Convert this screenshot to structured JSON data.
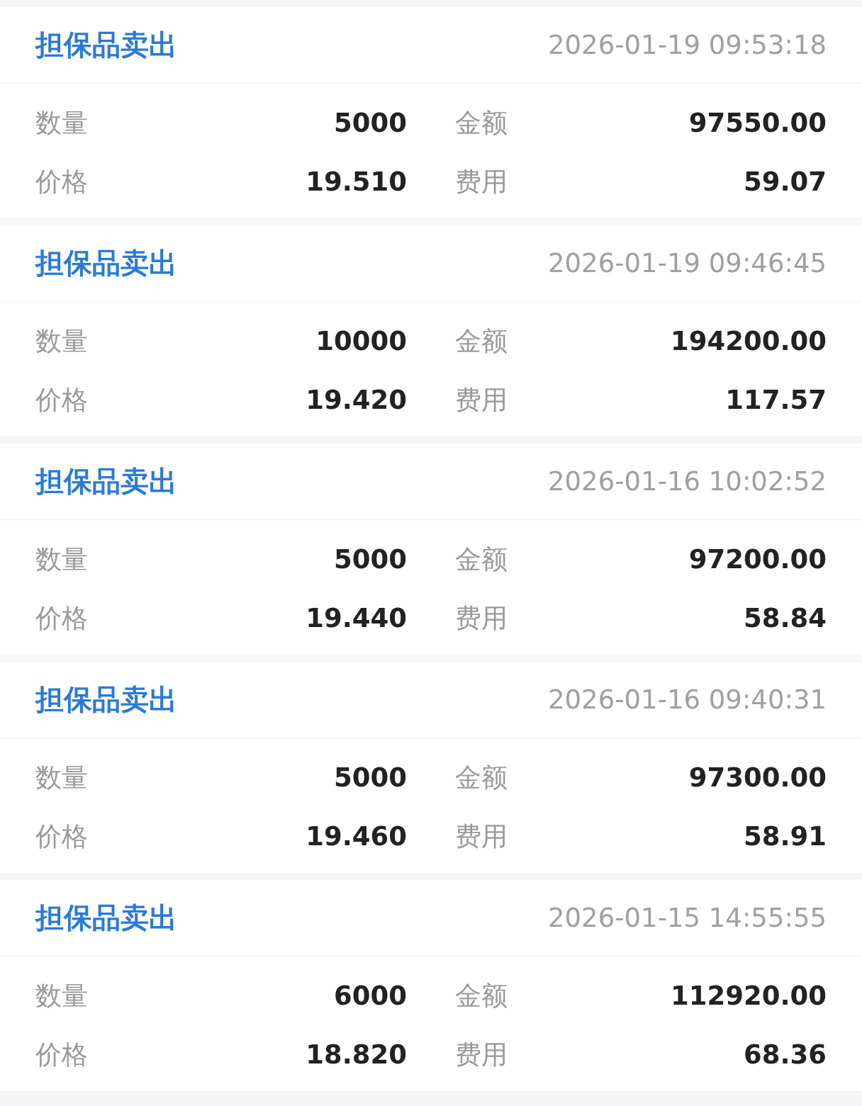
{
  "records": [
    {
      "title": "担保品卖出",
      "time": "2026-01-19 09:53:18",
      "fields": [
        {
          "label": "数量",
          "value": "5000"
        },
        {
          "label": "金额",
          "value": "97550.00"
        },
        {
          "label": "价格",
          "value": "19.510"
        },
        {
          "label": "费用",
          "value": "59.07"
        }
      ]
    },
    {
      "title": "担保品卖出",
      "time": "2026-01-19 09:46:45",
      "fields": [
        {
          "label": "数量",
          "value": "10000"
        },
        {
          "label": "金额",
          "value": "194200.00"
        },
        {
          "label": "价格",
          "value": "19.420"
        },
        {
          "label": "费用",
          "value": "117.57"
        }
      ]
    },
    {
      "title": "担保品卖出",
      "time": "2026-01-16 10:02:52",
      "fields": [
        {
          "label": "数量",
          "value": "5000"
        },
        {
          "label": "金额",
          "value": "97200.00"
        },
        {
          "label": "价格",
          "value": "19.440"
        },
        {
          "label": "费用",
          "value": "58.84"
        }
      ]
    },
    {
      "title": "担保品卖出",
      "time": "2026-01-16 09:40:31",
      "fields": [
        {
          "label": "数量",
          "value": "5000"
        },
        {
          "label": "金额",
          "value": "97300.00"
        },
        {
          "label": "价格",
          "value": "19.460"
        },
        {
          "label": "费用",
          "value": "58.91"
        }
      ]
    },
    {
      "title": "担保品卖出",
      "time": "2026-01-15 14:55:55",
      "fields": [
        {
          "label": "数量",
          "value": "6000"
        },
        {
          "label": "金额",
          "value": "112920.00"
        },
        {
          "label": "价格",
          "value": "18.820"
        },
        {
          "label": "费用",
          "value": "68.36"
        }
      ]
    }
  ]
}
